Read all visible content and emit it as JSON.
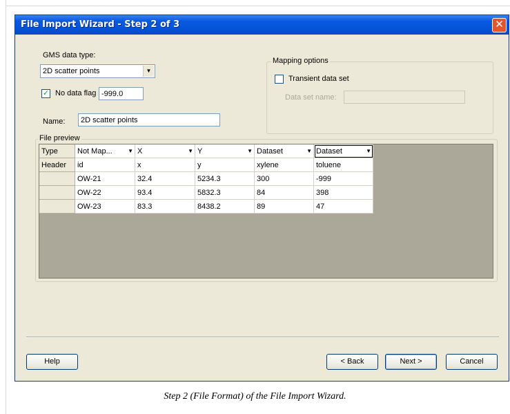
{
  "window": {
    "title": "File Import Wizard - Step 2 of 3",
    "close": "✕"
  },
  "gms_data_type": {
    "label": "GMS data type:",
    "value": "2D scatter points"
  },
  "no_data_flag": {
    "label": "No data flag",
    "checked": true,
    "value": "-999.0"
  },
  "name": {
    "label": "Name:",
    "value": "2D scatter points"
  },
  "mapping_options": {
    "title": "Mapping options",
    "transient_label": "Transient data set",
    "transient_checked": false,
    "data_set_name_label": "Data set name:",
    "data_set_name_value": ""
  },
  "file_preview": {
    "title": "File preview",
    "row_headers": [
      "Type",
      "Header",
      "",
      "",
      ""
    ],
    "types": [
      "Not Map...",
      "X",
      "Y",
      "Dataset",
      "Dataset"
    ],
    "headers": [
      "id",
      "x",
      "y",
      "xylene",
      "toluene"
    ],
    "rows": [
      [
        "OW-21",
        "32.4",
        "5234.3",
        "300",
        "-999"
      ],
      [
        "OW-22",
        "93.4",
        "5832.3",
        "84",
        "398"
      ],
      [
        "OW-23",
        "83.3",
        "8438.2",
        "89",
        "47"
      ]
    ]
  },
  "buttons": {
    "help": "Help",
    "back": "< Back",
    "next": "Next >",
    "cancel": "Cancel"
  },
  "caption": "Step 2 (File Format) of the File Import Wizard."
}
